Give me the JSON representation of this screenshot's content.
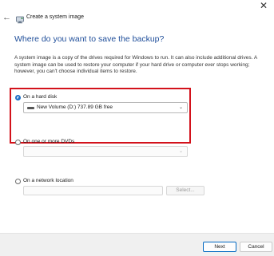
{
  "window": {
    "title": "Create a system image",
    "close_glyph": "✕",
    "back_glyph": "←"
  },
  "heading": "Where do you want to save the backup?",
  "description": "A system image is a copy of the drives required for Windows to run. It can also include additional drives. A system image can be used to restore your computer if your hard drive or computer ever stops working; however, you can't choose individual items to restore.",
  "options": {
    "hard_disk": {
      "label": "On a hard disk",
      "checked": true,
      "selected_drive": "New Volume (D:)  737.89 GB free"
    },
    "dvds": {
      "label": "On one or more DVDs",
      "checked": false,
      "selected_drive": ""
    },
    "network": {
      "label": "On a network location",
      "checked": false,
      "location_value": "",
      "select_button": "Select..."
    }
  },
  "footer": {
    "next": "Next",
    "cancel": "Cancel"
  },
  "colors": {
    "heading": "#1f4e9a",
    "highlight": "#d3121b",
    "accent": "#1f6fc5"
  },
  "icons": {
    "back": "back-arrow-icon",
    "app": "system-image-app-icon",
    "close": "close-icon",
    "drive": "drive-icon",
    "dropdown": "chevron-down-icon"
  }
}
